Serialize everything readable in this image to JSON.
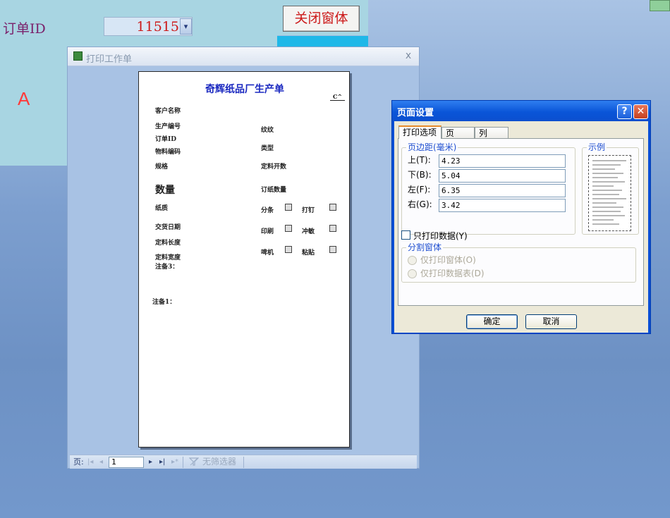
{
  "colors": {
    "form_bg": "#a8d5e2",
    "order_label": "#7a1f6a",
    "order_value": "#cc1a1a",
    "letter_a": "#ff3b3b",
    "sheet_title": "#1a28c0",
    "dialog_titlebar": "#0a55d8",
    "group_label": "#1f4fd0"
  },
  "form": {
    "order_label": "订单ID",
    "order_value": "11515",
    "combo_arrow": "▾",
    "letter_a": "A",
    "close_button": "关闭窗体"
  },
  "preview": {
    "title": "打印工作单",
    "close": "x",
    "sheet": {
      "title": "奇辉纸品厂生产单",
      "corner": "C^",
      "customer": "客户名称",
      "prod_no": "生产编号",
      "order_id": "订单ID",
      "material_code": "物料编码",
      "spec": "规格",
      "pattern": "纹纹",
      "type": "类型",
      "cut_open": "定料开数",
      "quantity": "数量",
      "paper_qty": "订纸数量",
      "paper_quality": "纸质",
      "slit": "分条",
      "staple": "打钉",
      "delivery": "交货日期",
      "print": "印刷",
      "die_cut": "冲敏",
      "cut_length": "定料长度",
      "machine": "啤机",
      "glue": "粘贴",
      "cut_width": "定料宽度",
      "remark3": "注备3：",
      "remark1": "注备1："
    },
    "status": {
      "page_label": "页:",
      "first": "|◂",
      "prev": "◂",
      "page_value": "1",
      "next": "▸",
      "last": "▸|",
      "new": "▸*",
      "filter_icon": "filter-icon",
      "no_filter": "无筛选器"
    }
  },
  "page_setup": {
    "title": "页面设置",
    "help": "?",
    "close": "✕",
    "tabs": [
      "打印选项",
      "页",
      "列"
    ],
    "margins_group": "页边距(毫米)",
    "sample_group": "示例",
    "margins": [
      {
        "label": "上(T):",
        "value": "4.23"
      },
      {
        "label": "下(B):",
        "value": "5.04"
      },
      {
        "label": "左(F):",
        "value": "6.35"
      },
      {
        "label": "右(G):",
        "value": "3.42"
      }
    ],
    "print_data_only": "只打印数据(Y)",
    "split_group": "分割窗体",
    "radio_form_only": "仅打印窗体(O)",
    "radio_datasheet_only": "仅打印数据表(D)",
    "ok": "确定",
    "cancel": "取消"
  }
}
